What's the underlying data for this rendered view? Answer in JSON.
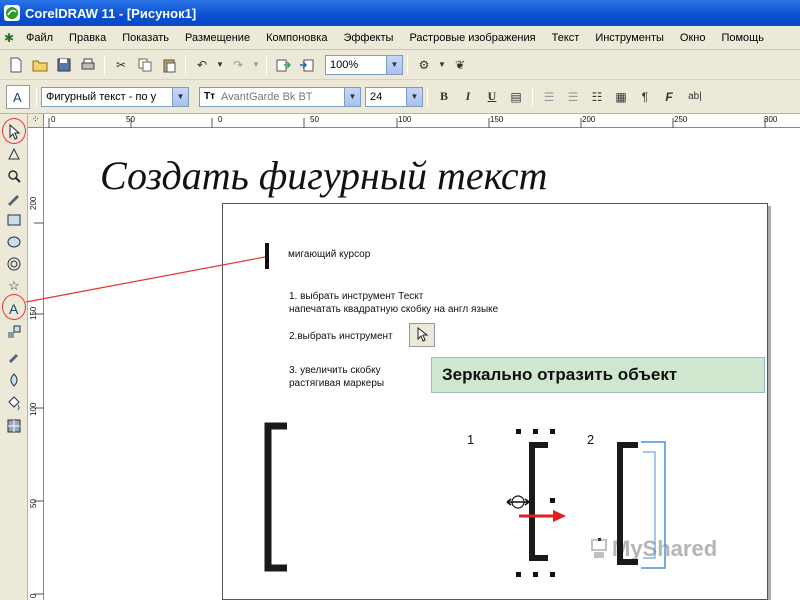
{
  "window": {
    "title": "CorelDRAW 11 - [Рисунок1]"
  },
  "menu": {
    "items": [
      "Файл",
      "Правка",
      "Показать",
      "Размещение",
      "Компоновка",
      "Эффекты",
      "Растровые изображения",
      "Текст",
      "Инструменты",
      "Окно",
      "Помощь"
    ]
  },
  "toolbar": {
    "zoom": "100%"
  },
  "property_bar": {
    "text_mode": "Фигурный текст - по у",
    "font_name": "AvantGarde Bk BT",
    "font_size": "24",
    "bold_label": "B",
    "italic_label": "I",
    "underline_label": "U",
    "frame_text_label": "ab|"
  },
  "ruler": {
    "h_ticks": [
      "0",
      "50",
      "0",
      "50",
      "100",
      "150",
      "200",
      "250",
      "300"
    ],
    "v_ticks": [
      "200",
      "150",
      "100",
      "50",
      "0"
    ]
  },
  "slide": {
    "heading": "Создать фигурный текст",
    "cursor_label": "мигающий курсор",
    "step1_line1": "1. выбрать инструмент Тескт",
    "step1_line2": "напечатать квадратную скобку на англ языке",
    "step2": "2.выбрать инструмент",
    "step3_line1": "3. увеличить скобку",
    "step3_line2": "растягивая маркеры",
    "banner": "Зеркально отразить объект",
    "num1": "1",
    "num2": "2",
    "watermark": "MyShared"
  },
  "colors": {
    "titlebar": "#0a50d0",
    "chrome": "#ece9d8",
    "callout_line": "#e33333",
    "arrow": "#e02020",
    "mirror_outline": "#4a90d9",
    "banner_bg": "#cfe6cf"
  }
}
